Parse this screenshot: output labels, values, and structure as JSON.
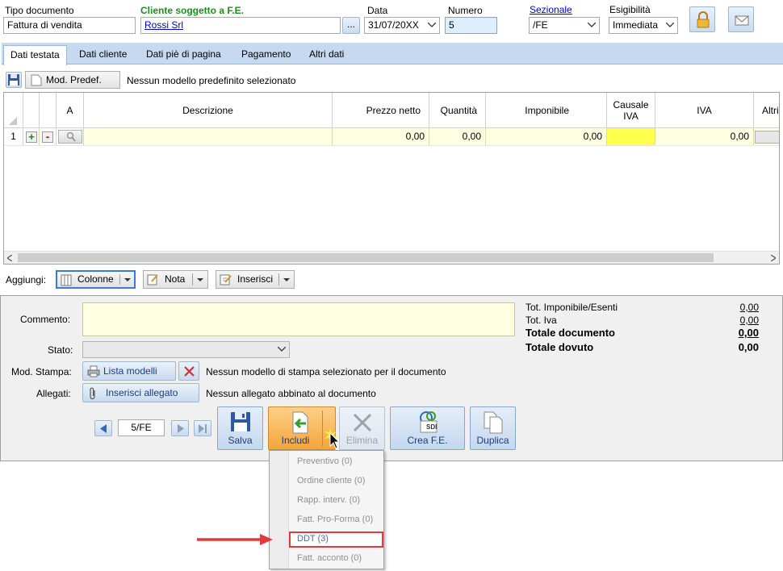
{
  "header": {
    "tipo_label": "Tipo documento",
    "tipo_value": "Fattura di vendita",
    "cliente_label": "Cliente soggetto a F.E.",
    "cliente_value": "Rossi Srl",
    "cliente_btn": "...",
    "data_label": "Data",
    "data_value": "31/07/20XX",
    "numero_label": "Numero",
    "numero_value": "5",
    "sezionale_label": "Sezionale",
    "sezionale_value": "/FE",
    "esigibilita_label": "Esigibilità",
    "esigibilita_value": "Immediata"
  },
  "tabs": [
    "Dati testata",
    "Dati cliente",
    "Dati piè di pagina",
    "Pagamento",
    "Altri dati"
  ],
  "toolbar": {
    "mod_predef_label": "Mod. Predef.",
    "mod_predef_status": "Nessun modello predefinito selezionato"
  },
  "grid": {
    "columns": [
      "A",
      "Descrizione",
      "Prezzo netto",
      "Quantità",
      "Imponibile",
      "Causale IVA",
      "IVA",
      "Altri"
    ],
    "row": {
      "num": "1",
      "plus": "+",
      "minus": "-",
      "prezzo": "0,00",
      "quantita": "0,00",
      "imponibile": "0,00",
      "iva": "0,00"
    }
  },
  "aggiungi": {
    "label": "Aggiungi:",
    "colonne": "Colonne",
    "nota": "Nota",
    "inserisci": "Inserisci"
  },
  "form": {
    "commento_label": "Commento:",
    "stato_label": "Stato:",
    "mod_stampa_label": "Mod. Stampa:",
    "lista_modelli": "Lista modelli",
    "mod_stampa_status": "Nessun modello di stampa selezionato per il documento",
    "allegati_label": "Allegati:",
    "inserisci_allegato": "Inserisci allegato",
    "allegati_status": "Nessun allegato abbinato al documento"
  },
  "totals": {
    "imponibile_label": "Tot. Imponibile/Esenti",
    "imponibile_value": "0,00",
    "iva_label": "Tot. Iva",
    "iva_value": "0,00",
    "totale_label": "Totale documento",
    "totale_value": "0,00",
    "dovuto_label": "Totale dovuto",
    "dovuto_value": "0,00"
  },
  "nav": {
    "record": "5/FE"
  },
  "actions": {
    "salva": "Salva",
    "includi": "Includi",
    "elimina": "Elimina",
    "crea_fe": "Crea F.E.",
    "sdi": "SDI",
    "duplica": "Duplica"
  },
  "includi_menu": [
    "Preventivo (0)",
    "Ordine cliente (0)",
    "Rapp. interv. (0)",
    "Fatt. Pro-Forma (0)",
    "DDT (3)",
    "Fatt. acconto (0)"
  ],
  "colors": {
    "accent_green": "#1a8f1a",
    "link_blue": "#0000cc",
    "highlight_red": "#e03b3b",
    "row_yellow": "#ffffe1",
    "causale_yellow": "#ffff4d",
    "includi_orange": "#f4a53a"
  }
}
